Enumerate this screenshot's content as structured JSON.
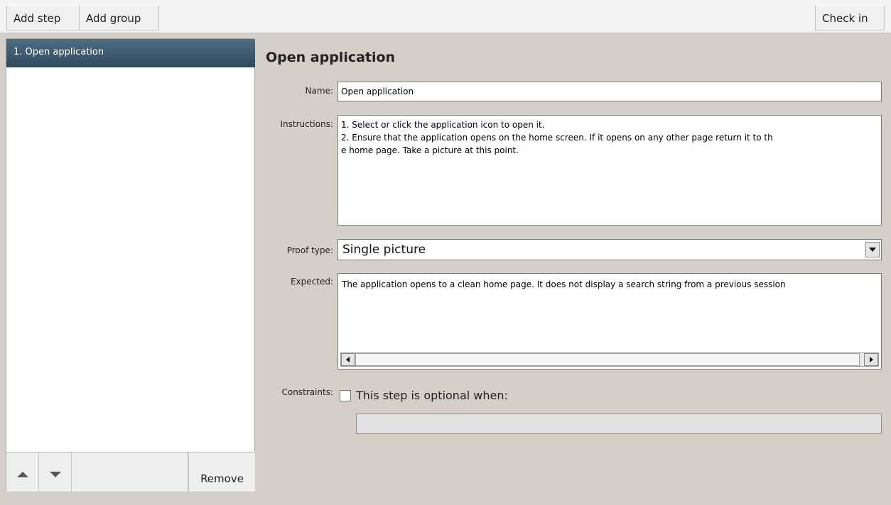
{
  "toolbar": {
    "add_step": "Add step",
    "add_group": "Add group",
    "check_in": "Check in"
  },
  "steps": {
    "items": [
      {
        "label": "1. Open application",
        "selected": true
      }
    ],
    "move_up_icon": "arrow-up",
    "move_down_icon": "arrow-down",
    "remove_label": "Remove"
  },
  "form": {
    "title": "Open application",
    "name_label": "Name:",
    "name_value": "Open application",
    "instructions_label": "Instructions:",
    "instructions_value": "1. Select or click the application icon to open it.\n2. Ensure that the application opens on the home screen. If it opens on any other page return it to th\ne home page. Take a picture at this point.",
    "proof_type_label": "Proof type:",
    "proof_type_value": "Single picture",
    "expected_label": "Expected:",
    "expected_value": "The application opens to a clean home page. It does not display a search string from a previous session",
    "constraints_label": "Constraints:",
    "optional_checkbox_label": "This step is optional when:",
    "optional_checked": false,
    "optional_condition_value": ""
  },
  "colors": {
    "selected_item_bg": "#3a566b",
    "panel_bg": "#d4d0c8"
  }
}
